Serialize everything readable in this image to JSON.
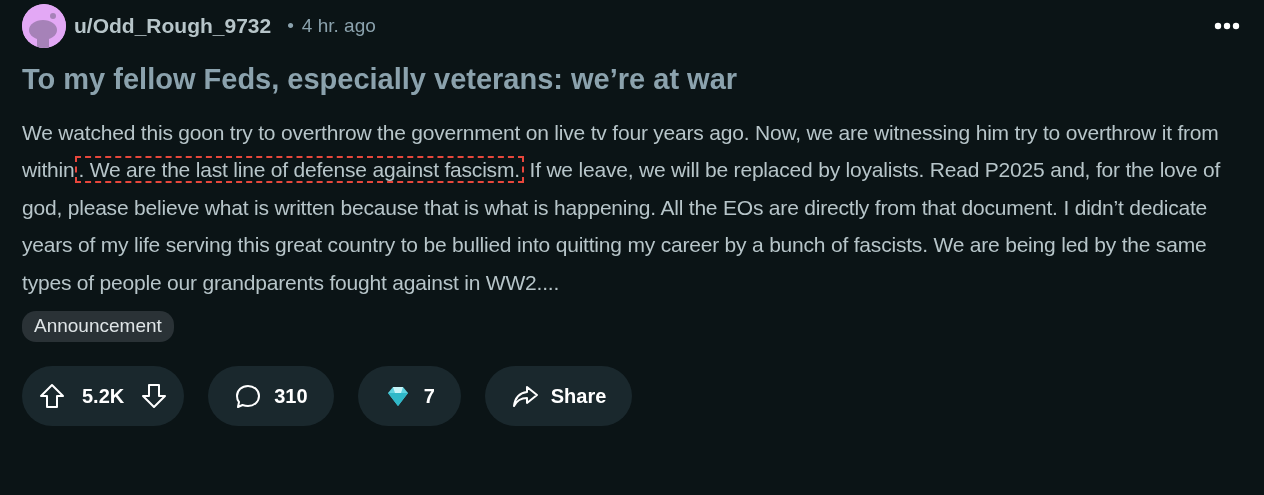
{
  "post": {
    "author": "u/Odd_Rough_9732",
    "separator": "•",
    "time": "4 hr. ago",
    "title": "To my fellow Feds, especially veterans: we’re at war",
    "body": {
      "before": "We watched this goon try to overthrow the government on live tv four years ago. Now, we are witnessing him try to overthrow it from within",
      "highlighted": ". We are the last line of defense against fascism.",
      "after": " If we leave, we will be replaced by loyalists. Read P2025 and, for the love of god, please believe what is written because that is what is happening. All the EOs are directly from that document. I didn’t dedicate years of my life serving this great country to be bullied into quitting my career by a bunch of fascists. We are being led by the same types of people our grandparents fought against in WW2...."
    },
    "flair": "Announcement"
  },
  "actions": [
    {
      "kind": "vote",
      "label": "5.2K"
    },
    {
      "kind": "comments",
      "label": "310"
    },
    {
      "kind": "award",
      "label": "7"
    },
    {
      "kind": "share",
      "label": "Share"
    }
  ]
}
